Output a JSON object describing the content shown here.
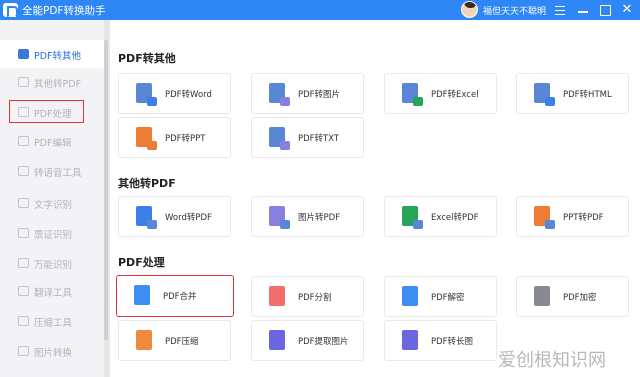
{
  "titlebar": {
    "app_title": "全能PDF转换助手",
    "user_name": "福但天天不聪明"
  },
  "sidebar": {
    "items": [
      {
        "label": "PDF转其他",
        "icon": "pdf-to-other-icon"
      },
      {
        "label": "其他转PDF",
        "icon": "other-to-pdf-icon"
      },
      {
        "label": "PDF处理",
        "icon": "pdf-process-icon"
      },
      {
        "label": "PDF编辑",
        "icon": "pdf-edit-icon"
      },
      {
        "label": "转语音工具",
        "icon": "voice-icon"
      },
      {
        "label": "文字识别",
        "icon": "ocr-icon"
      },
      {
        "label": "票证识别",
        "icon": "ticket-icon"
      },
      {
        "label": "万能识别",
        "icon": "universal-recognize-icon"
      },
      {
        "label": "翻译工具",
        "icon": "translate-icon"
      },
      {
        "label": "压缩工具",
        "icon": "compress-icon"
      },
      {
        "label": "图片转换",
        "icon": "image-convert-icon"
      }
    ]
  },
  "sections": [
    {
      "title": "PDF转其他",
      "cards": [
        {
          "label": "PDF转Word",
          "icon": "word-icon"
        },
        {
          "label": "PDF转图片",
          "icon": "image-icon"
        },
        {
          "label": "PDF转Excel",
          "icon": "excel-icon"
        },
        {
          "label": "PDF转HTML",
          "icon": "html-icon"
        },
        {
          "label": "PDF转PPT",
          "icon": "ppt-icon"
        },
        {
          "label": "PDF转TXT",
          "icon": "txt-icon"
        }
      ]
    },
    {
      "title": "其他转PDF",
      "cards": [
        {
          "label": "Word转PDF",
          "icon": "word-icon"
        },
        {
          "label": "图片转PDF",
          "icon": "image-icon"
        },
        {
          "label": "Excel转PDF",
          "icon": "excel-icon"
        },
        {
          "label": "PPT转PDF",
          "icon": "ppt-icon"
        }
      ]
    },
    {
      "title": "PDF处理",
      "cards": [
        {
          "label": "PDF合并",
          "icon": "merge-icon"
        },
        {
          "label": "PDF分割",
          "icon": "split-icon"
        },
        {
          "label": "PDF解密",
          "icon": "unlock-icon"
        },
        {
          "label": "PDF加密",
          "icon": "lock-icon"
        },
        {
          "label": "PDF压缩",
          "icon": "compress-icon"
        },
        {
          "label": "PDF提取图片",
          "icon": "extract-image-icon"
        },
        {
          "label": "PDF转长图",
          "icon": "long-image-icon"
        }
      ]
    }
  ],
  "watermark": "爱创根知识网"
}
